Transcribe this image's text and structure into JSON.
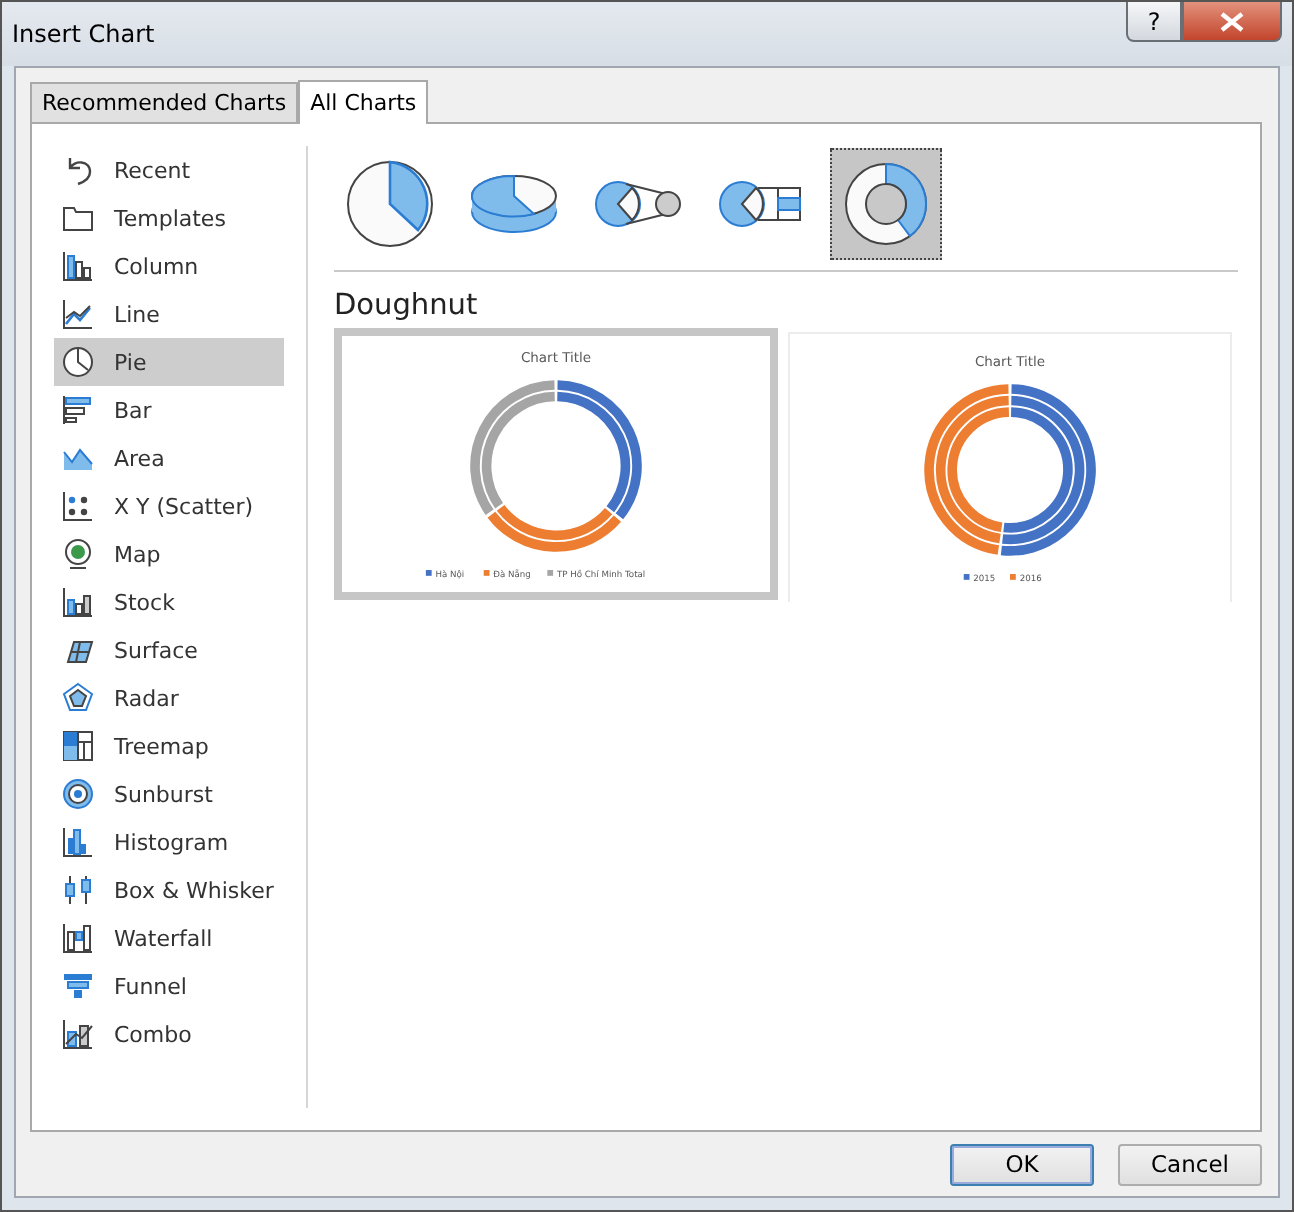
{
  "window": {
    "title": "Insert Chart",
    "help_button": "?"
  },
  "tabs": [
    {
      "label": "Recommended Charts",
      "selected": false
    },
    {
      "label": "All Charts",
      "selected": true
    }
  ],
  "chart_types": [
    {
      "label": "Recent",
      "selected": false
    },
    {
      "label": "Templates",
      "selected": false
    },
    {
      "label": "Column",
      "selected": false
    },
    {
      "label": "Line",
      "selected": false
    },
    {
      "label": "Pie",
      "selected": true
    },
    {
      "label": "Bar",
      "selected": false
    },
    {
      "label": "Area",
      "selected": false
    },
    {
      "label": "X Y (Scatter)",
      "selected": false
    },
    {
      "label": "Map",
      "selected": false
    },
    {
      "label": "Stock",
      "selected": false
    },
    {
      "label": "Surface",
      "selected": false
    },
    {
      "label": "Radar",
      "selected": false
    },
    {
      "label": "Treemap",
      "selected": false
    },
    {
      "label": "Sunburst",
      "selected": false
    },
    {
      "label": "Histogram",
      "selected": false
    },
    {
      "label": "Box & Whisker",
      "selected": false
    },
    {
      "label": "Waterfall",
      "selected": false
    },
    {
      "label": "Funnel",
      "selected": false
    },
    {
      "label": "Combo",
      "selected": false
    }
  ],
  "subtypes": [
    {
      "selected": false
    },
    {
      "selected": false
    },
    {
      "selected": false
    },
    {
      "selected": false
    },
    {
      "selected": true
    }
  ],
  "subtype_heading": "Doughnut",
  "previews": [
    {
      "selected": true,
      "title": "Chart Title",
      "legend": [
        {
          "label": "Hà Nội",
          "color": "#4472c4"
        },
        {
          "label": "Đà Nẵng",
          "color": "#ed7d31"
        },
        {
          "label": "TP Hồ Chí Minh Total",
          "color": "#a5a5a5"
        }
      ]
    },
    {
      "selected": false,
      "title": "Chart Title",
      "legend": [
        {
          "label": "2015",
          "color": "#4472c4"
        },
        {
          "label": "2016",
          "color": "#ed7d31"
        }
      ]
    }
  ],
  "buttons": [
    {
      "label": "OK",
      "default": true
    },
    {
      "label": "Cancel",
      "default": false
    }
  ]
}
